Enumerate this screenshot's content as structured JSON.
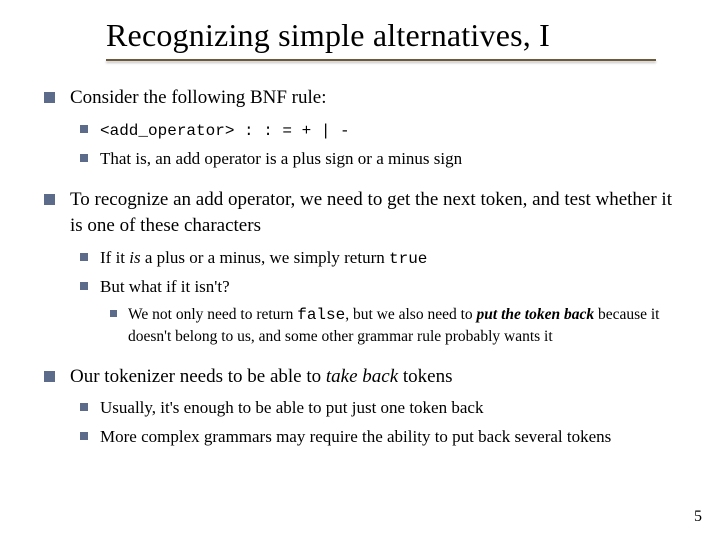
{
  "title": "Recognizing simple alternatives, I",
  "bullets": {
    "b1": "Consider the following BNF rule:",
    "b1_1": "<add_operator> : : = + | -",
    "b1_2": "That is, an add operator is a plus sign or a minus sign",
    "b2": "To recognize an add operator, we need to get the next token, and test whether it is one of these characters",
    "b2_1_pre": "If it ",
    "b2_1_is": "is",
    "b2_1_mid": " a plus or a minus, we simply return ",
    "b2_1_true": "true",
    "b2_2": "But what if it isn't?",
    "b2_2_1_a": "We not only need to return ",
    "b2_2_1_false": "false",
    "b2_2_1_b": ", but we also need to ",
    "b2_2_1_put": "put the token back",
    "b2_2_1_c": " because it doesn't belong to us, and some other grammar rule probably wants it",
    "b3_a": "Our tokenizer needs to be able to ",
    "b3_take": "take back",
    "b3_b": " tokens",
    "b3_1": "Usually, it's enough to be able to put just one token back",
    "b3_2": "More complex grammars may require the ability to put back several tokens"
  },
  "page_number": "5"
}
